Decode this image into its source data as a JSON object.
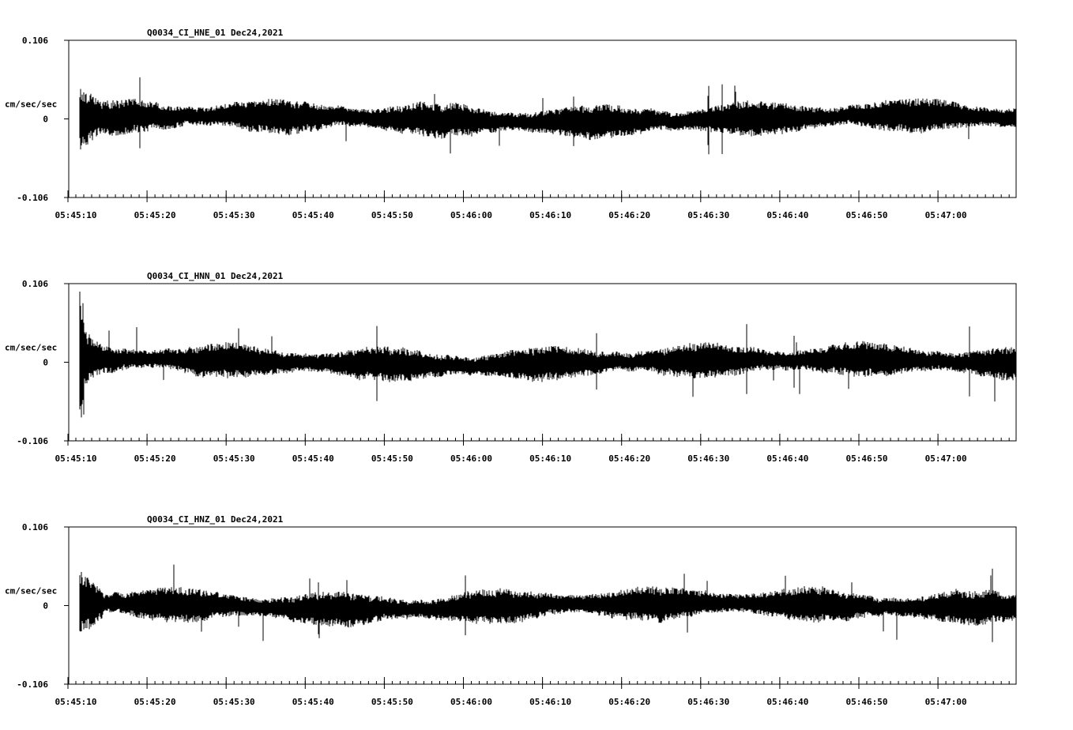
{
  "chart_data": [
    {
      "type": "line",
      "title": "Q0034_CI_HNE_01  Dec24,2021",
      "ylabel": "cm/sec/sec",
      "ylim": [
        -0.106,
        0.106
      ],
      "y_tick_labels": [
        "0.106",
        "0",
        "-0.106"
      ],
      "x_tick_labels": [
        "05:45:10",
        "05:45:20",
        "05:45:30",
        "05:45:40",
        "05:45:50",
        "05:46:00",
        "05:46:10",
        "05:46:20",
        "05:46:30",
        "05:46:40",
        "05:46:50",
        "05:47:00"
      ],
      "grid": false,
      "color": "#000000"
    },
    {
      "type": "line",
      "title": "Q0034_CI_HNN_01  Dec24,2021",
      "ylabel": "cm/sec/sec",
      "ylim": [
        -0.106,
        0.106
      ],
      "y_tick_labels": [
        "0.106",
        "0",
        "-0.106"
      ],
      "x_tick_labels": [
        "05:45:10",
        "05:45:20",
        "05:45:30",
        "05:45:40",
        "05:45:50",
        "05:46:00",
        "05:46:10",
        "05:46:20",
        "05:46:30",
        "05:46:40",
        "05:46:50",
        "05:47:00"
      ],
      "grid": false,
      "color": "#000000"
    },
    {
      "type": "line",
      "title": "Q0034_CI_HNZ_01  Dec24,2021",
      "ylabel": "cm/sec/sec",
      "ylim": [
        -0.106,
        0.106
      ],
      "y_tick_labels": [
        "0.106",
        "0",
        "-0.106"
      ],
      "x_tick_labels": [
        "05:45:10",
        "05:45:20",
        "05:45:30",
        "05:45:40",
        "05:45:50",
        "05:46:00",
        "05:46:10",
        "05:46:20",
        "05:46:30",
        "05:46:40",
        "05:46:50",
        "05:47:00"
      ],
      "grid": false,
      "color": "#000000"
    }
  ]
}
